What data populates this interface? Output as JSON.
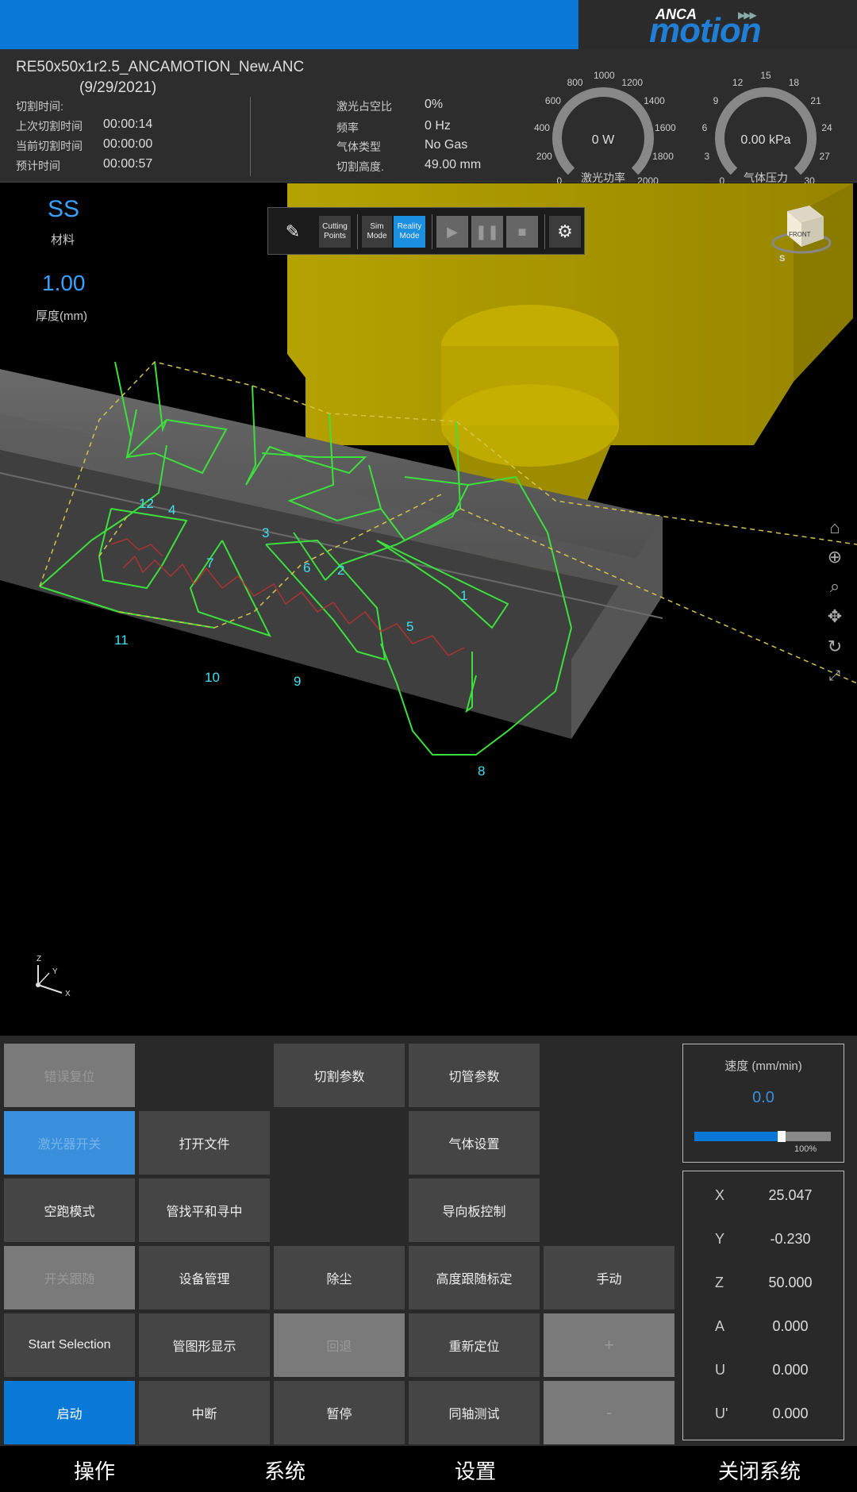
{
  "brand": {
    "top": "ANCA",
    "main": "motion"
  },
  "header": {
    "file_name": "RE50x50x1r2.5_ANCAMOTION_New.ANC",
    "file_date": "(9/29/2021)",
    "times": [
      {
        "label": "切割时间:",
        "value": ""
      },
      {
        "label": "上次切割时间",
        "value": "00:00:14"
      },
      {
        "label": "当前切割时间",
        "value": "00:00:00"
      },
      {
        "label": "预计时间",
        "value": "00:00:57"
      }
    ],
    "params": [
      {
        "label": "激光占空比",
        "value": "0%"
      },
      {
        "label": "频率",
        "value": "0 Hz"
      },
      {
        "label": "气体类型",
        "value": "No Gas"
      },
      {
        "label": "切割高度.",
        "value": "49.00 mm"
      }
    ]
  },
  "gauges": {
    "laser": {
      "value": "0 W",
      "label": "激光功率",
      "level": 0,
      "ticks": [
        "0",
        "200",
        "400",
        "600",
        "800",
        "1000",
        "1200",
        "1400",
        "1600",
        "1800",
        "2000"
      ]
    },
    "gas": {
      "value": "0.00 kPa",
      "label": "气体压力",
      "level": 0,
      "ticks": [
        "0",
        "3",
        "6",
        "9",
        "12",
        "15",
        "18",
        "21",
        "24",
        "27",
        "30"
      ]
    }
  },
  "material": {
    "value": "SS",
    "label": "材料"
  },
  "thickness": {
    "value": "1.00",
    "label": "厚度(mm)"
  },
  "toolbar": {
    "cutting_points": "Cutting Points",
    "sim_mode": "Sim Mode",
    "reality_mode": "Reality Mode"
  },
  "view_cube": {
    "face": "FRONT"
  },
  "axis_triad": {
    "z": "Z",
    "y": "Y",
    "x": "X"
  },
  "path_labels": [
    "1",
    "2",
    "3",
    "4",
    "5",
    "6",
    "7",
    "8",
    "9",
    "10",
    "11",
    "12"
  ],
  "buttons": {
    "error_reset": "错误复位",
    "laser_ready": "激光器开关",
    "open_file": "打开文件",
    "dry_run": "空跑模式",
    "tube_level_center": "管找平和寻中",
    "follow_toggle": "开关跟随",
    "device_mgmt": "设备管理",
    "start_selection": "Start Selection",
    "tube_display": "管图形显示",
    "start": "启动",
    "interrupt": "中断",
    "cut_params": "切割参数",
    "dust": "除尘",
    "retract": "回退",
    "pause": "暂停",
    "pipe_params": "切管参数",
    "gas_settings": "气体设置",
    "guide_plate": "导向板控制",
    "height_calib": "高度跟随标定",
    "reposition": "重新定位",
    "coaxial_test": "同轴测试",
    "manual": "手动",
    "plus": "+",
    "minus": "-"
  },
  "speed": {
    "label": "速度 (mm/min)",
    "value": "0.0",
    "percent_label": "100%",
    "percent": 0.62
  },
  "coords": [
    {
      "axis": "X",
      "value": "25.047"
    },
    {
      "axis": "Y",
      "value": "-0.230"
    },
    {
      "axis": "Z",
      "value": "50.000"
    },
    {
      "axis": "A",
      "value": "0.000"
    },
    {
      "axis": "U",
      "value": "0.000"
    },
    {
      "axis": "U'",
      "value": "0.000"
    }
  ],
  "nav": [
    "操作",
    "系统",
    "设置",
    "关闭系统"
  ]
}
